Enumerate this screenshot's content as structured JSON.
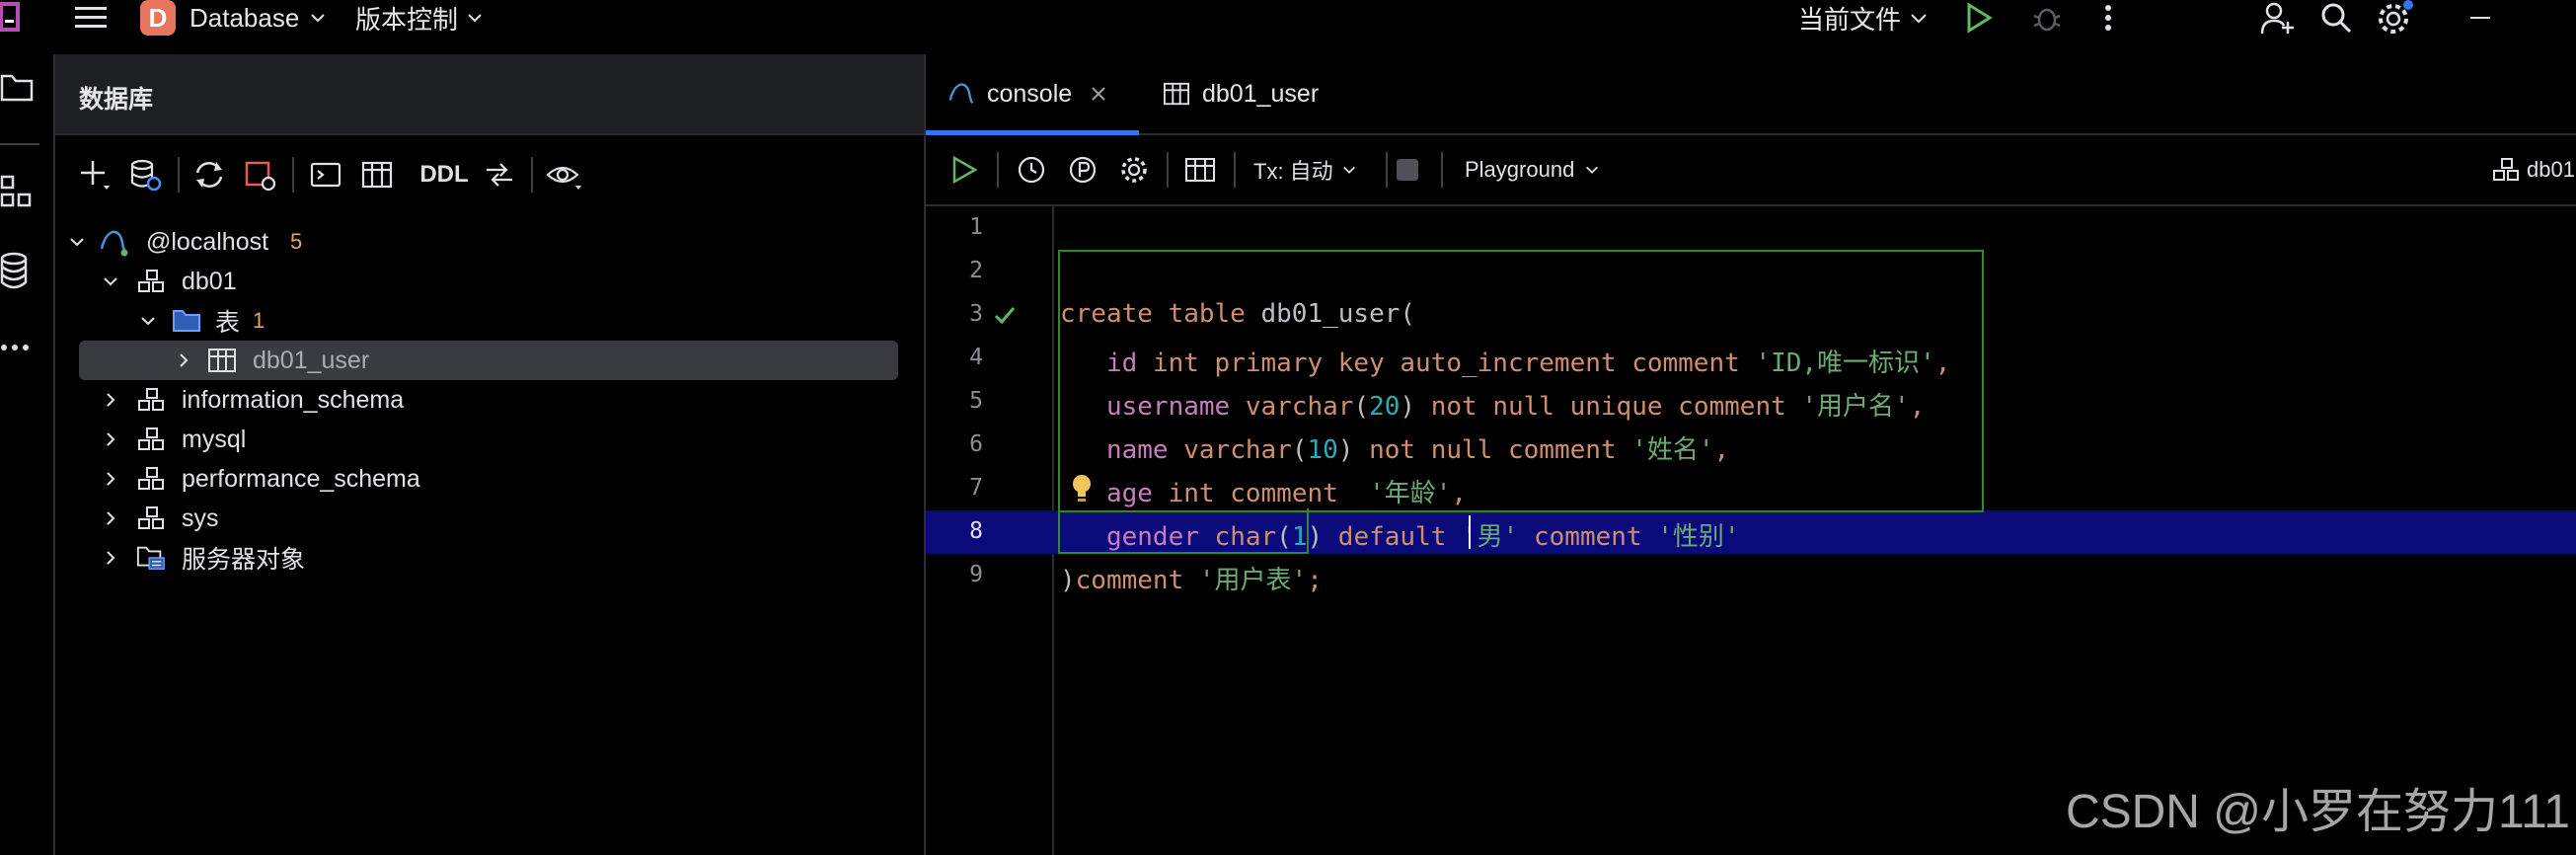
{
  "topbar": {
    "project_initial": "D",
    "project_name": "Database",
    "vcs_menu": "版本控制",
    "run_config": "当前文件"
  },
  "db_panel": {
    "title": "数据库",
    "ddl_label": "DDL",
    "tree": [
      {
        "label": "@localhost",
        "count": "5"
      },
      {
        "label": "db01"
      },
      {
        "label": "表",
        "count": "1"
      },
      {
        "label": "db01_user"
      },
      {
        "label": "information_schema"
      },
      {
        "label": "mysql"
      },
      {
        "label": "performance_schema"
      },
      {
        "label": "sys"
      },
      {
        "label": "服务器对象"
      }
    ]
  },
  "editor": {
    "tabs": [
      {
        "label": "console",
        "active": true
      },
      {
        "label": "db01_user",
        "active": false
      }
    ],
    "toolbar": {
      "tx_label": "Tx: 自动",
      "playground_label": "Playground",
      "datasource_label": "db01"
    },
    "line_numbers": [
      "1",
      "2",
      "3",
      "4",
      "5",
      "6",
      "7",
      "8",
      "9"
    ],
    "current_line": 8
  },
  "colors": {
    "accent": "#3574f0",
    "keyword": "#cf8e6d",
    "string": "#6aab73",
    "number": "#2aacb8",
    "function": "#c77dbb",
    "current_line": "#0a0a7a",
    "check": "#5fb865"
  },
  "watermark": "CSDN @小罗在努力111"
}
